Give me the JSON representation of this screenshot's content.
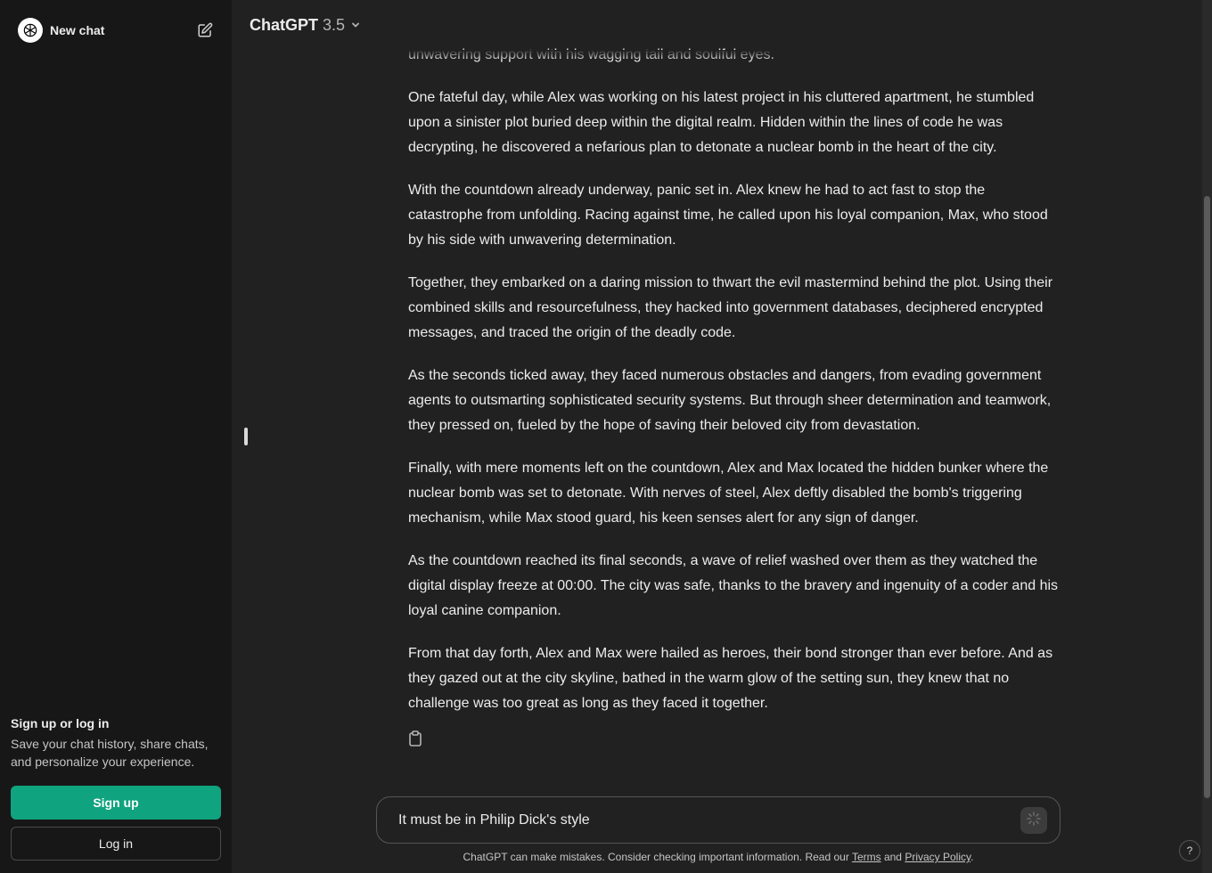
{
  "sidebar": {
    "new_chat_label": "New chat",
    "signup_title": "Sign up or log in",
    "signup_desc": "Save your chat history, share chats, and personalize your experience.",
    "signup_button": "Sign up",
    "login_button": "Log in"
  },
  "header": {
    "model_name": "ChatGPT",
    "model_version": "3.5"
  },
  "message": {
    "paragraphs": [
      "unwavering support with his wagging tail and soulful eyes.",
      "One fateful day, while Alex was working on his latest project in his cluttered apartment, he stumbled upon a sinister plot buried deep within the digital realm. Hidden within the lines of code he was decrypting, he discovered a nefarious plan to detonate a nuclear bomb in the heart of the city.",
      "With the countdown already underway, panic set in. Alex knew he had to act fast to stop the catastrophe from unfolding. Racing against time, he called upon his loyal companion, Max, who stood by his side with unwavering determination.",
      "Together, they embarked on a daring mission to thwart the evil mastermind behind the plot. Using their combined skills and resourcefulness, they hacked into government databases, deciphered encrypted messages, and traced the origin of the deadly code.",
      "As the seconds ticked away, they faced numerous obstacles and dangers, from evading government agents to outsmarting sophisticated security systems. But through sheer determination and teamwork, they pressed on, fueled by the hope of saving their beloved city from devastation.",
      "Finally, with mere moments left on the countdown, Alex and Max located the hidden bunker where the nuclear bomb was set to detonate. With nerves of steel, Alex deftly disabled the bomb's triggering mechanism, while Max stood guard, his keen senses alert for any sign of danger.",
      "As the countdown reached its final seconds, a wave of relief washed over them as they watched the digital display freeze at 00:00. The city was safe, thanks to the bravery and ingenuity of a coder and his loyal canine companion.",
      "From that day forth, Alex and Max were hailed as heroes, their bond stronger than ever before. And as they gazed out at the city skyline, bathed in the warm glow of the setting sun, they knew that no challenge was too great as long as they faced it together."
    ]
  },
  "composer": {
    "input_value": "It must be in Philip Dick's style"
  },
  "footer": {
    "disclaimer_prefix": "ChatGPT can make mistakes. Consider checking important information. Read our ",
    "terms_link": "Terms",
    "and_text": " and ",
    "privacy_link": "Privacy Policy",
    "suffix": "."
  },
  "help": "?",
  "colors": {
    "sidebar_bg": "#171717",
    "main_bg": "#212121",
    "accent": "#10a37f"
  }
}
